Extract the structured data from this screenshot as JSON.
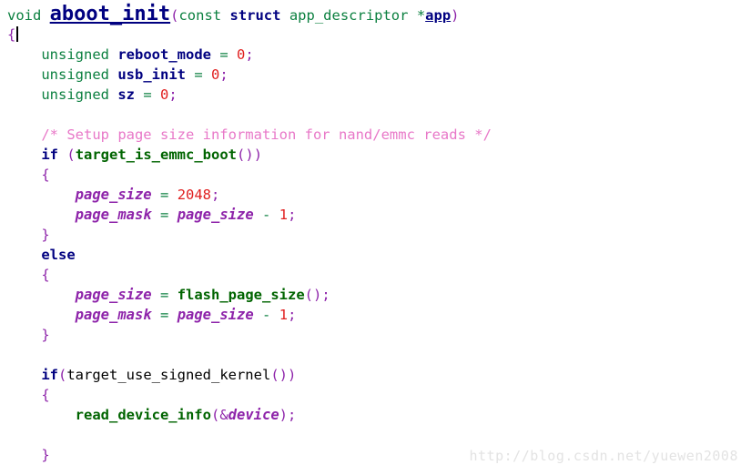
{
  "editor": {
    "language": "C",
    "background_color": "#ffffff",
    "font_size_px": 15.5,
    "line_height_px": 22,
    "caret_line": 2,
    "caret_column": 2
  },
  "palette": {
    "keyword": "#000080",
    "type": "#0c8040",
    "function_declaration": "#000080",
    "function_call": "#006400",
    "variable": "#000080",
    "member": "#8e24aa",
    "punctuation": "#8e24aa",
    "operator": "#0c8040",
    "number": "#e02020",
    "comment": "#e878c8",
    "plain": "#000000",
    "watermark": "#e3e3e3"
  },
  "code_lines": [
    {
      "n": 1,
      "indent": 0,
      "tokens": [
        {
          "text": "void",
          "cls": "t-type"
        },
        {
          "text": " ",
          "cls": "t-plain"
        },
        {
          "text": "aboot_init",
          "cls": "t-fndecl"
        },
        {
          "text": "(",
          "cls": "t-punct"
        },
        {
          "text": "const",
          "cls": "t-type"
        },
        {
          "text": " ",
          "cls": "t-plain"
        },
        {
          "text": "struct",
          "cls": "t-kw"
        },
        {
          "text": " ",
          "cls": "t-plain"
        },
        {
          "text": "app_descriptor",
          "cls": "t-type"
        },
        {
          "text": " ",
          "cls": "t-plain"
        },
        {
          "text": "*",
          "cls": "t-type"
        },
        {
          "text": "app",
          "cls": "t-param"
        },
        {
          "text": ")",
          "cls": "t-punct"
        }
      ]
    },
    {
      "n": 2,
      "indent": 0,
      "caret_after": true,
      "tokens": [
        {
          "text": "{",
          "cls": "t-punct"
        }
      ]
    },
    {
      "n": 3,
      "indent": 4,
      "tokens": [
        {
          "text": "unsigned",
          "cls": "t-type"
        },
        {
          "text": " ",
          "cls": "t-plain"
        },
        {
          "text": "reboot_mode",
          "cls": "t-var"
        },
        {
          "text": " ",
          "cls": "t-plain"
        },
        {
          "text": "=",
          "cls": "t-op"
        },
        {
          "text": " ",
          "cls": "t-plain"
        },
        {
          "text": "0",
          "cls": "t-num"
        },
        {
          "text": ";",
          "cls": "t-punct"
        }
      ]
    },
    {
      "n": 4,
      "indent": 4,
      "tokens": [
        {
          "text": "unsigned",
          "cls": "t-type"
        },
        {
          "text": " ",
          "cls": "t-plain"
        },
        {
          "text": "usb_init",
          "cls": "t-var"
        },
        {
          "text": " ",
          "cls": "t-plain"
        },
        {
          "text": "=",
          "cls": "t-op"
        },
        {
          "text": " ",
          "cls": "t-plain"
        },
        {
          "text": "0",
          "cls": "t-num"
        },
        {
          "text": ";",
          "cls": "t-punct"
        }
      ]
    },
    {
      "n": 5,
      "indent": 4,
      "tokens": [
        {
          "text": "unsigned",
          "cls": "t-type"
        },
        {
          "text": " ",
          "cls": "t-plain"
        },
        {
          "text": "sz",
          "cls": "t-var"
        },
        {
          "text": " ",
          "cls": "t-plain"
        },
        {
          "text": "=",
          "cls": "t-op"
        },
        {
          "text": " ",
          "cls": "t-plain"
        },
        {
          "text": "0",
          "cls": "t-num"
        },
        {
          "text": ";",
          "cls": "t-punct"
        }
      ]
    },
    {
      "n": 6,
      "indent": 0,
      "tokens": []
    },
    {
      "n": 7,
      "indent": 4,
      "tokens": [
        {
          "text": "/* Setup page size information for nand/emmc reads */",
          "cls": "t-comment"
        }
      ]
    },
    {
      "n": 8,
      "indent": 4,
      "tokens": [
        {
          "text": "if",
          "cls": "t-kw"
        },
        {
          "text": " ",
          "cls": "t-plain"
        },
        {
          "text": "(",
          "cls": "t-punct"
        },
        {
          "text": "target_is_emmc_boot",
          "cls": "t-fn"
        },
        {
          "text": "(",
          "cls": "t-punct"
        },
        {
          "text": ")",
          "cls": "t-punct"
        },
        {
          "text": ")",
          "cls": "t-punct"
        }
      ]
    },
    {
      "n": 9,
      "indent": 4,
      "tokens": [
        {
          "text": "{",
          "cls": "t-punct"
        }
      ]
    },
    {
      "n": 10,
      "indent": 8,
      "tokens": [
        {
          "text": "page_size",
          "cls": "t-member"
        },
        {
          "text": " ",
          "cls": "t-plain"
        },
        {
          "text": "=",
          "cls": "t-op"
        },
        {
          "text": " ",
          "cls": "t-plain"
        },
        {
          "text": "2048",
          "cls": "t-num"
        },
        {
          "text": ";",
          "cls": "t-punct"
        }
      ]
    },
    {
      "n": 11,
      "indent": 8,
      "tokens": [
        {
          "text": "page_mask",
          "cls": "t-member"
        },
        {
          "text": " ",
          "cls": "t-plain"
        },
        {
          "text": "=",
          "cls": "t-op"
        },
        {
          "text": " ",
          "cls": "t-plain"
        },
        {
          "text": "page_size",
          "cls": "t-member"
        },
        {
          "text": " ",
          "cls": "t-plain"
        },
        {
          "text": "-",
          "cls": "t-op"
        },
        {
          "text": " ",
          "cls": "t-plain"
        },
        {
          "text": "1",
          "cls": "t-num"
        },
        {
          "text": ";",
          "cls": "t-punct"
        }
      ]
    },
    {
      "n": 12,
      "indent": 4,
      "tokens": [
        {
          "text": "}",
          "cls": "t-punct"
        }
      ]
    },
    {
      "n": 13,
      "indent": 4,
      "tokens": [
        {
          "text": "else",
          "cls": "t-kw"
        }
      ]
    },
    {
      "n": 14,
      "indent": 4,
      "tokens": [
        {
          "text": "{",
          "cls": "t-punct"
        }
      ]
    },
    {
      "n": 15,
      "indent": 8,
      "tokens": [
        {
          "text": "page_size",
          "cls": "t-member"
        },
        {
          "text": " ",
          "cls": "t-plain"
        },
        {
          "text": "=",
          "cls": "t-op"
        },
        {
          "text": " ",
          "cls": "t-plain"
        },
        {
          "text": "flash_page_size",
          "cls": "t-fn"
        },
        {
          "text": "(",
          "cls": "t-punct"
        },
        {
          "text": ")",
          "cls": "t-punct"
        },
        {
          "text": ";",
          "cls": "t-punct"
        }
      ]
    },
    {
      "n": 16,
      "indent": 8,
      "tokens": [
        {
          "text": "page_mask",
          "cls": "t-member"
        },
        {
          "text": " ",
          "cls": "t-plain"
        },
        {
          "text": "=",
          "cls": "t-op"
        },
        {
          "text": " ",
          "cls": "t-plain"
        },
        {
          "text": "page_size",
          "cls": "t-member"
        },
        {
          "text": " ",
          "cls": "t-plain"
        },
        {
          "text": "-",
          "cls": "t-op"
        },
        {
          "text": " ",
          "cls": "t-plain"
        },
        {
          "text": "1",
          "cls": "t-num"
        },
        {
          "text": ";",
          "cls": "t-punct"
        }
      ]
    },
    {
      "n": 17,
      "indent": 4,
      "tokens": [
        {
          "text": "}",
          "cls": "t-punct"
        }
      ]
    },
    {
      "n": 18,
      "indent": 0,
      "tokens": []
    },
    {
      "n": 19,
      "indent": 4,
      "tokens": [
        {
          "text": "if",
          "cls": "t-kw"
        },
        {
          "text": "(",
          "cls": "t-punct"
        },
        {
          "text": "target_use_signed_kernel",
          "cls": "t-plain"
        },
        {
          "text": "(",
          "cls": "t-punct"
        },
        {
          "text": ")",
          "cls": "t-punct"
        },
        {
          "text": ")",
          "cls": "t-punct"
        }
      ]
    },
    {
      "n": 20,
      "indent": 4,
      "tokens": [
        {
          "text": "{",
          "cls": "t-punct"
        }
      ]
    },
    {
      "n": 21,
      "indent": 8,
      "tokens": [
        {
          "text": "read_device_info",
          "cls": "t-fn"
        },
        {
          "text": "(",
          "cls": "t-punct"
        },
        {
          "text": "&",
          "cls": "t-amp"
        },
        {
          "text": "device",
          "cls": "t-member"
        },
        {
          "text": ")",
          "cls": "t-punct"
        },
        {
          "text": ";",
          "cls": "t-punct"
        }
      ]
    },
    {
      "n": 22,
      "indent": 0,
      "tokens": []
    },
    {
      "n": 23,
      "indent": 4,
      "tokens": [
        {
          "text": "}",
          "cls": "t-punct"
        }
      ]
    }
  ],
  "watermark": {
    "text": "http://blog.csdn.net/yuewen2008"
  }
}
